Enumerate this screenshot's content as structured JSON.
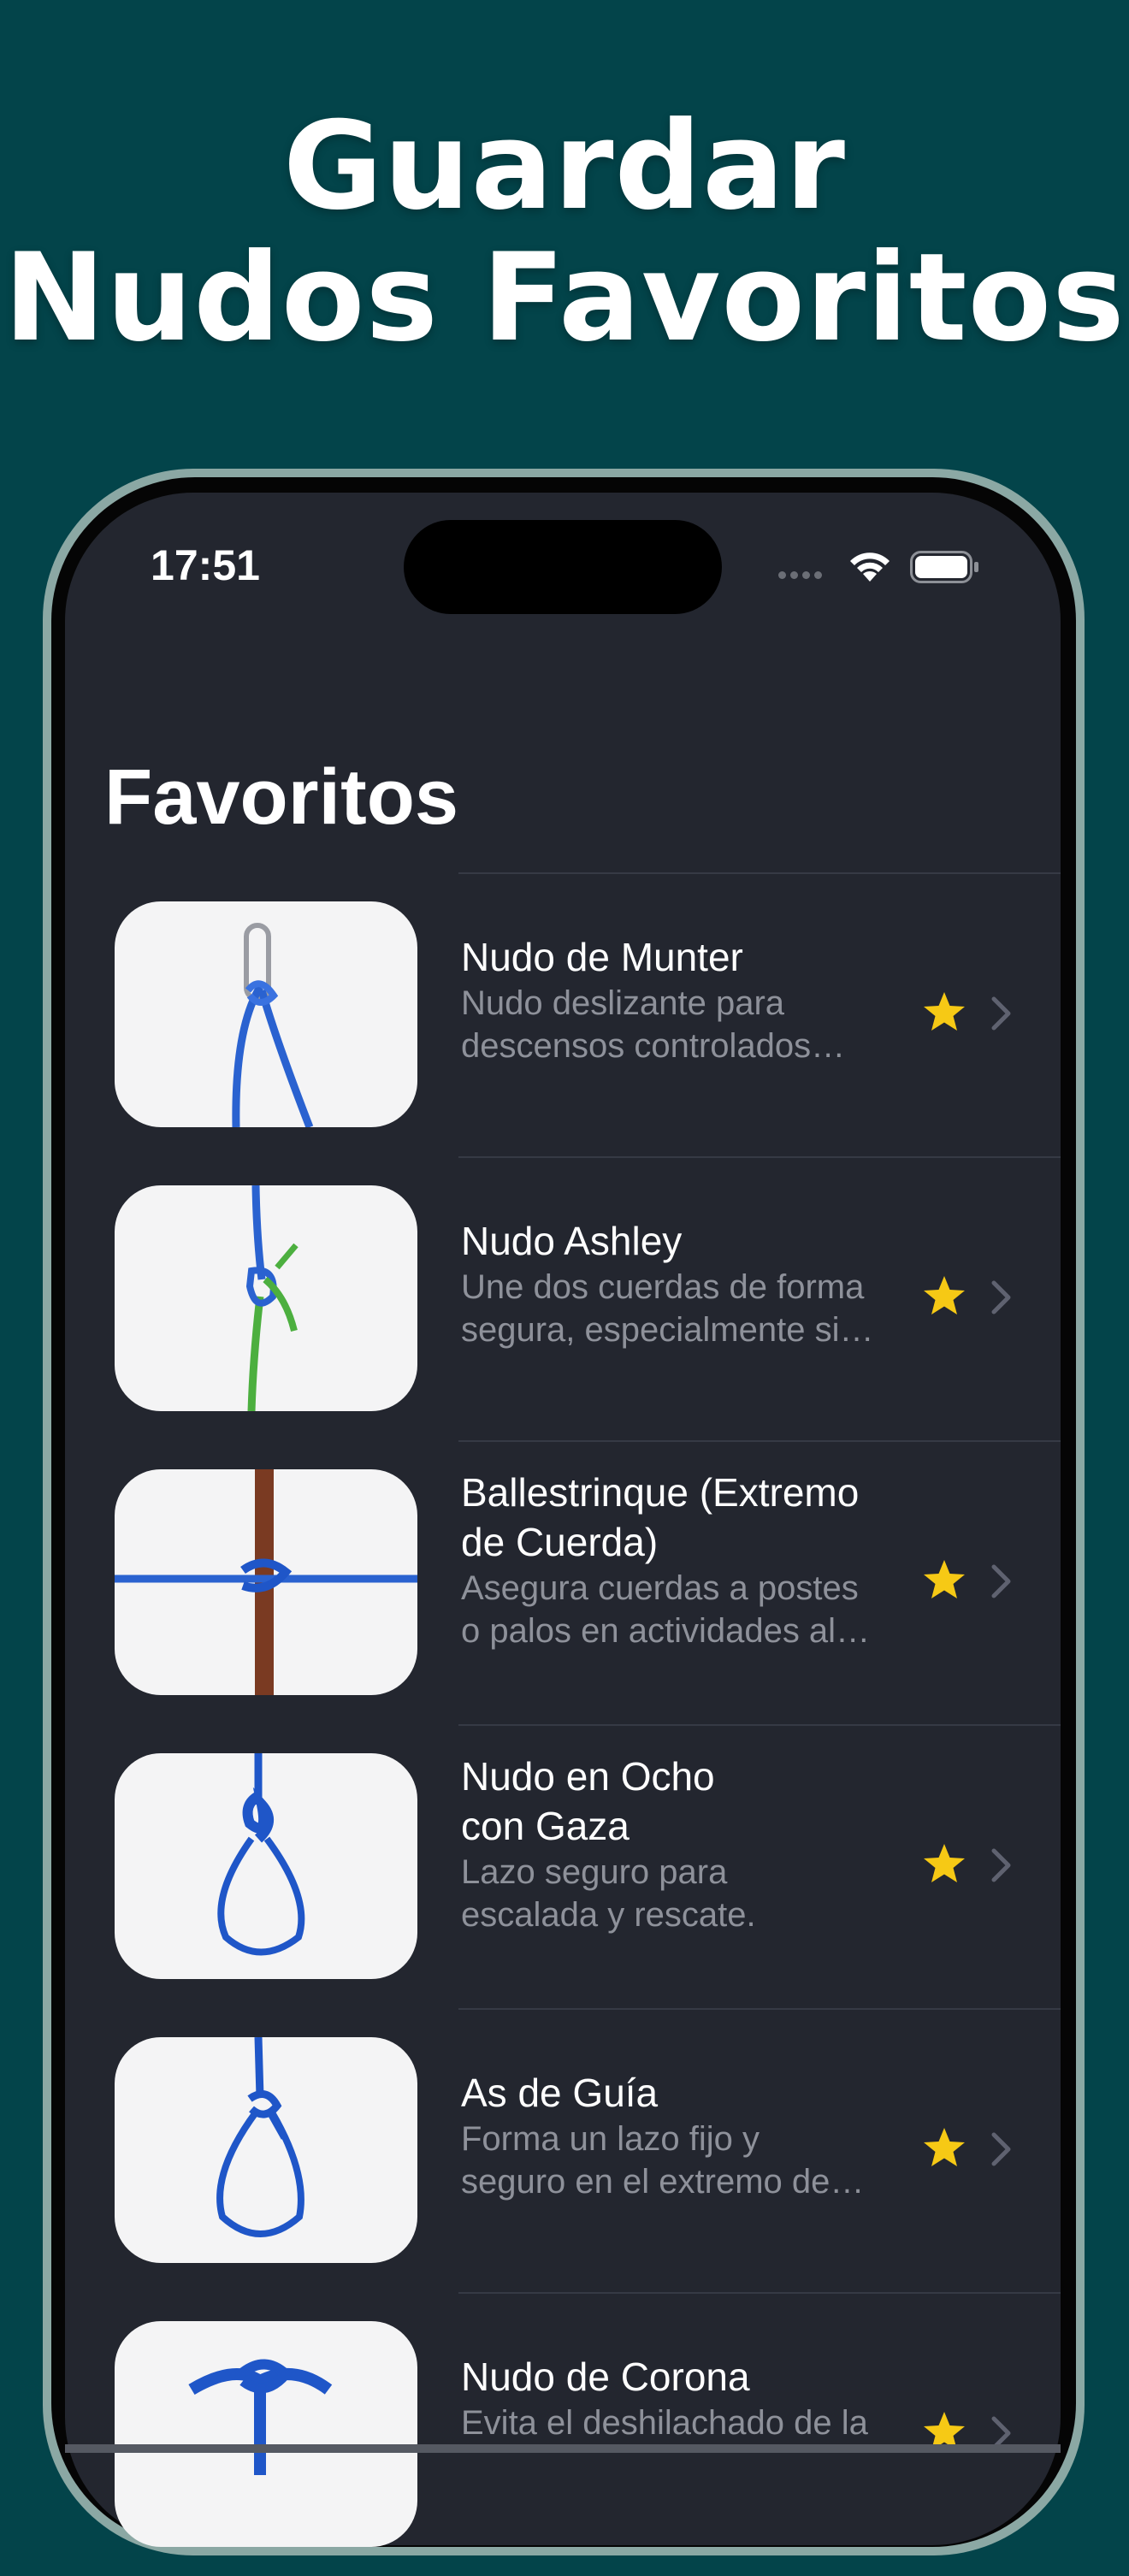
{
  "headline": {
    "line1": "Guardar",
    "line2": "Nudos Favoritos"
  },
  "status_bar": {
    "time": "17:51",
    "icons": [
      "signal-dots-icon",
      "wifi-icon",
      "battery-icon"
    ]
  },
  "screen_title": "Favoritos",
  "colors": {
    "background": "#03444a",
    "screen": "#23262f",
    "star": "#f6c915",
    "rope_blue": "#1f56c8",
    "rope_green": "#4caf3f",
    "pole": "#7a3a22"
  },
  "knots": [
    {
      "name": "Nudo de Munter",
      "desc1": "Nudo deslizante para",
      "desc2": "descensos controlados…",
      "favorite": true,
      "thumb": "munter-knot-image"
    },
    {
      "name": "Nudo Ashley",
      "desc1": "Une dos cuerdas de forma",
      "desc2": "segura, especialmente si…",
      "favorite": true,
      "thumb": "ashley-knot-image"
    },
    {
      "name1": "Ballestrinque (Extremo",
      "name2": "de Cuerda)",
      "desc1": "Asegura cuerdas a postes",
      "desc2": "o palos en actividades al…",
      "favorite": true,
      "thumb": "clove-hitch-image"
    },
    {
      "name1": "Nudo en Ocho",
      "name2": "con Gaza",
      "desc1": "Lazo seguro para",
      "desc2": "escalada y rescate.",
      "favorite": true,
      "thumb": "figure-eight-loop-image"
    },
    {
      "name": "As de Guía",
      "desc1": "Forma un lazo fijo y",
      "desc2": "seguro en el extremo de…",
      "favorite": true,
      "thumb": "bowline-image"
    },
    {
      "name": "Nudo de Corona",
      "desc1": "Evita el deshilachado de la",
      "favorite": true,
      "thumb": "crown-knot-image"
    }
  ]
}
